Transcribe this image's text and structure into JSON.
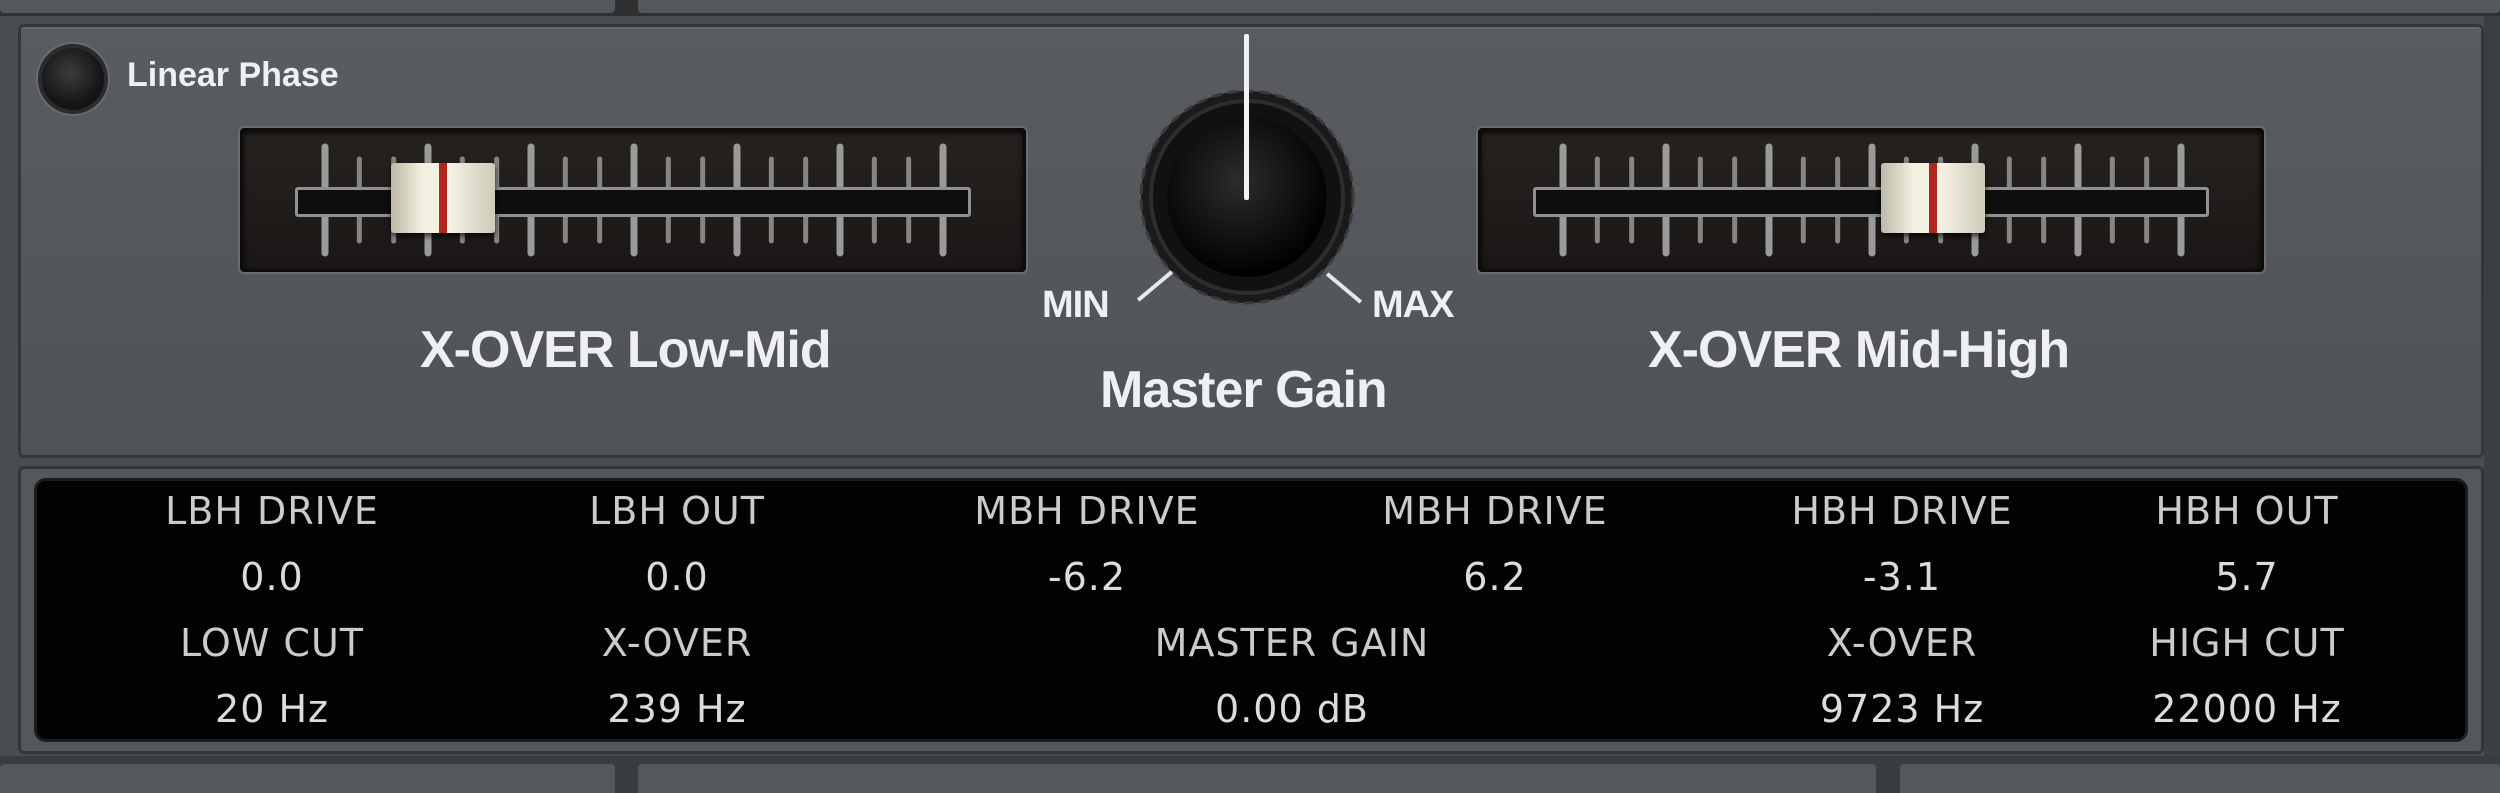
{
  "linear_phase": {
    "label": "Linear Phase",
    "enabled": false
  },
  "xover_low_mid": {
    "label": "X-OVER Low-Mid",
    "position": 0.18
  },
  "xover_mid_high": {
    "label": "X-OVER Mid-High",
    "position": 0.6
  },
  "master_gain": {
    "label": "Master Gain",
    "min_label": "MIN",
    "max_label": "MAX"
  },
  "display": {
    "row1": [
      {
        "label": "LBH DRIVE",
        "value": "0.0"
      },
      {
        "label": "LBH OUT",
        "value": "0.0"
      },
      {
        "label": "MBH DRIVE",
        "value": "-6.2"
      },
      {
        "label": "MBH DRIVE",
        "value": "6.2"
      },
      {
        "label": "HBH DRIVE",
        "value": "-3.1"
      },
      {
        "label": "HBH OUT",
        "value": "5.7"
      }
    ],
    "row2": [
      {
        "label": "LOW CUT",
        "value": "20 Hz"
      },
      {
        "label": "X-OVER",
        "value": "239 Hz"
      },
      {
        "label": "MASTER GAIN",
        "value": "0.00 dB"
      },
      {
        "label": "X-OVER",
        "value": "9723 Hz"
      },
      {
        "label": "HIGH CUT",
        "value": "22000 Hz"
      }
    ]
  },
  "colors": {
    "panel": "#55585b",
    "slider_marker": "#b3261e",
    "display_bg": "#030303",
    "display_text": "#c9cbcd"
  }
}
